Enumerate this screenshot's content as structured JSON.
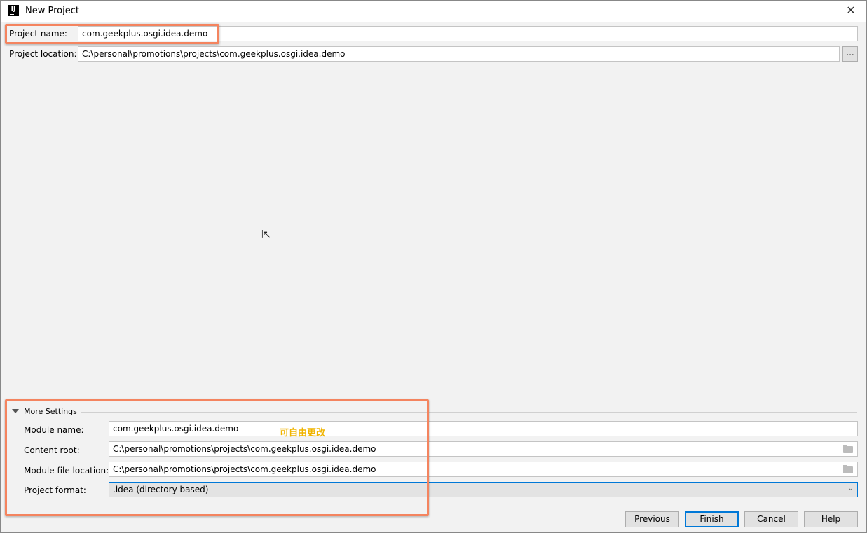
{
  "window": {
    "title": "New Project",
    "logo_text": "IJ",
    "close_icon": "close-icon"
  },
  "project": {
    "name_label": "Project name:",
    "name_value": "com.geekplus.osgi.idea.demo",
    "location_label": "Project location:",
    "location_value": "C:\\personal\\promotions\\projects\\com.geekplus.osgi.idea.demo",
    "browse_label": "..."
  },
  "more_settings": {
    "title": "More Settings",
    "module_name_label": "Module name:",
    "module_name_value": "com.geekplus.osgi.idea.demo",
    "content_root_label": "Content root:",
    "content_root_value": "C:\\personal\\promotions\\projects\\com.geekplus.osgi.idea.demo",
    "module_file_label": "Module file location:",
    "module_file_value": "C:\\personal\\promotions\\projects\\com.geekplus.osgi.idea.demo",
    "format_label": "Project format:",
    "format_value": ".idea (directory based)"
  },
  "annotation": {
    "text": "可自由更改",
    "color": "#f0b400",
    "highlight_color": "#f4845f"
  },
  "buttons": {
    "previous": "Previous",
    "finish": "Finish",
    "cancel": "Cancel",
    "help": "Help"
  },
  "colors": {
    "accent": "#0078d7",
    "background": "#f2f2f2"
  }
}
